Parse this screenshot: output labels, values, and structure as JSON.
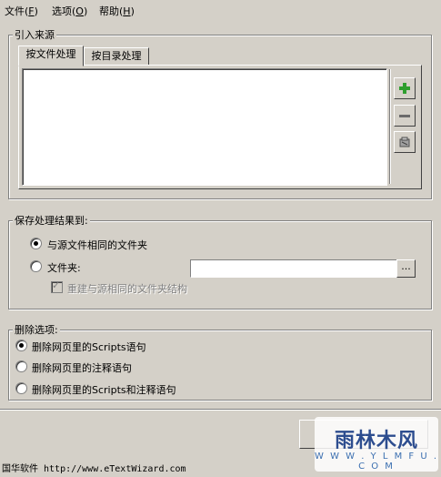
{
  "menu": {
    "file": "文件",
    "file_acc": "F",
    "options": "选项",
    "options_acc": "O",
    "help": "帮助",
    "help_acc": "H"
  },
  "source_group": {
    "title": "引入来源",
    "tabs": [
      "按文件处理",
      "按目录处理"
    ],
    "buttons": {
      "add_icon": "plus-icon",
      "remove_icon": "minus-icon",
      "clear_icon": "eraser-icon"
    }
  },
  "save_group": {
    "title": "保存处理结果到:",
    "option_same_folder": "与源文件相同的文件夹",
    "option_folder": "文件夹:",
    "folder_value": "",
    "browse_label": "...",
    "rebuild_structure": "重建与源相同的文件夹结构"
  },
  "delete_group": {
    "title": "删除选项:",
    "options": [
      "删除网页里的Scripts语句",
      "删除网页里的注释语句",
      "删除网页里的Scripts和注释语句"
    ]
  },
  "watermark": {
    "title": "雨林木风",
    "url": "W W W . Y L M F U . C O M"
  },
  "status_bar": "国华软件 http://www.eTextWizard.com",
  "colors": {
    "background": "#d4d0c8",
    "add_icon": "#2e9e2e"
  }
}
